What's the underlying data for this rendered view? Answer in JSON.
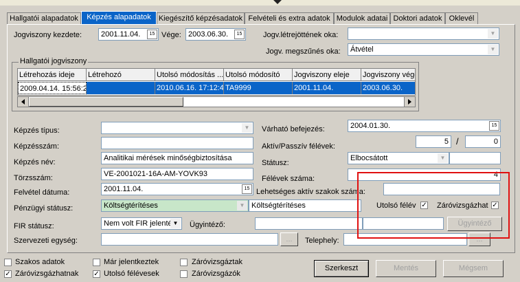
{
  "tabs": [
    {
      "label": "Hallgatói alapadatok",
      "active": false
    },
    {
      "label": "Képzés alapadatok",
      "active": true
    },
    {
      "label": "Kiegészítő képzésadatok",
      "active": false
    },
    {
      "label": "Felvételi és extra adatok",
      "active": false
    },
    {
      "label": "Modulok adatai",
      "active": false
    },
    {
      "label": "Doktori adatok",
      "active": false
    },
    {
      "label": "Oklevél",
      "active": false
    }
  ],
  "top": {
    "start_label": "Jogviszony kezdete:",
    "start_value": "2001.11.04.",
    "end_label": "Vége:",
    "end_value": "2003.06.30.",
    "reason_create_label": "Jogv.létrejöttének oka:",
    "reason_create_value": "",
    "reason_end_label": "Jogv. megszűnés oka:",
    "reason_end_value": "Átvétel"
  },
  "grid": {
    "title": "Hallgatói jogviszony",
    "headers": [
      "Létrehozás ideje",
      "Létrehozó",
      "Utolsó módosítás ...",
      "Utolsó módosító",
      "Jogviszony eleje",
      "Jogviszony vége"
    ],
    "row": [
      "2009.04.14. 15:56:2",
      "",
      "2010.06.16. 17:12:4",
      "TA9999",
      "2001.11.04.",
      "2003.06.30."
    ]
  },
  "left": {
    "kepzes_tipus_label": "Képzés típus:",
    "kepzes_tipus_value": "",
    "kepzesszam_label": "Képzésszám:",
    "kepzesszam_value": "",
    "kepzes_nev_label": "Képzés név:",
    "kepzes_nev_value": "Analitikai mérések minőségbiztosítása",
    "torzsszam_label": "Törzsszám:",
    "torzsszam_value": "VE-2001021-16A-AM-YOVK93",
    "felvetel_label": "Felvétel dátuma:",
    "felvetel_value": "2001.11.04.",
    "penzugyi_label": "Pénzügyi státusz:",
    "penzugyi_value": "Költségtérítéses",
    "penzugyi_value2": "Költségtérítéses",
    "fir_label": "FIR státusz:",
    "fir_value": "Nem volt FIR jelentés",
    "ugyintezo_label": "Ügyintéző:",
    "ugyintezo_value": "",
    "szervezeti_label": "Szervezeti egység:",
    "szervezeti_value": "",
    "telephely_label": "Telephely:",
    "telephely_value": "",
    "browse": "..."
  },
  "right": {
    "varhato_label": "Várható befejezés:",
    "varhato_value": "2004.01.30.",
    "aktiv_label": "Aktív/Passzív félévek:",
    "aktiv_value": "5",
    "slash": "/",
    "passziv_value": "0",
    "statusz_label": "Státusz:",
    "statusz_value": "Elbocsátott",
    "felevek_label": "Félévek száma:",
    "felevek_value": "4",
    "lehetseges_label": "Lehetséges aktív szakok száma:",
    "lehetseges_value": "",
    "utolso_label": "Utolsó félév",
    "utolso_checked": true,
    "zaro_label": "Záróvizsgázhat",
    "zaro_checked": true,
    "ugyintezo_btn": "Ügyintéző"
  },
  "bottom": {
    "checks": [
      {
        "label": "Szakos adatok",
        "checked": false
      },
      {
        "label": "Záróvizsgázhatnak",
        "checked": true
      },
      {
        "label": "Már jelentkeztek",
        "checked": false
      },
      {
        "label": "Utolsó félévesek",
        "checked": true
      },
      {
        "label": "Záróvizsgáztak",
        "checked": false
      },
      {
        "label": "Záróvizsgázók",
        "checked": false
      }
    ],
    "szerkeszt": "Szerkeszt",
    "mentes": "Mentés",
    "megsem": "Mégsem"
  },
  "colors": {
    "accent": "#0a64c8",
    "highlight_box": "#e01010",
    "green_field": "#c8e6c9"
  }
}
